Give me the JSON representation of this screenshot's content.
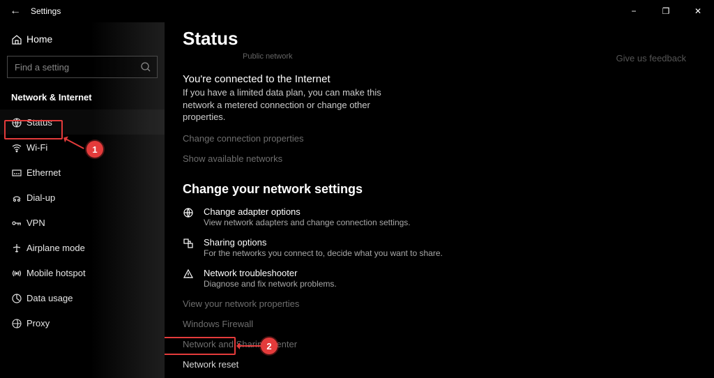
{
  "window": {
    "title": "Settings"
  },
  "sidebar": {
    "home": "Home",
    "search_placeholder": "Find a setting",
    "category": "Network & Internet",
    "items": [
      {
        "icon": "globe",
        "label": "Status"
      },
      {
        "icon": "wifi",
        "label": "Wi-Fi"
      },
      {
        "icon": "ethernet",
        "label": "Ethernet"
      },
      {
        "icon": "dialup",
        "label": "Dial-up"
      },
      {
        "icon": "vpn",
        "label": "VPN"
      },
      {
        "icon": "airplane",
        "label": "Airplane mode"
      },
      {
        "icon": "hotspot",
        "label": "Mobile hotspot"
      },
      {
        "icon": "data",
        "label": "Data usage"
      },
      {
        "icon": "proxy",
        "label": "Proxy"
      }
    ]
  },
  "main": {
    "page_title": "Status",
    "public_label": "Public network",
    "feedback": "Give us feedback",
    "connected_title": "You're connected to the Internet",
    "connected_sub": "If you have a limited data plan, you can make this network a metered connection or change other properties.",
    "link_props": "Change connection properties",
    "link_show": "Show available networks",
    "change_heading": "Change your network settings",
    "options": [
      {
        "title": "Change adapter options",
        "desc": "View network adapters and change connection settings."
      },
      {
        "title": "Sharing options",
        "desc": "For the networks you connect to, decide what you want to share."
      },
      {
        "title": "Network troubleshooter",
        "desc": "Diagnose and fix network problems."
      }
    ],
    "dim_links": [
      "View your network properties",
      "Windows Firewall",
      "Network and Sharing Center",
      "Network reset"
    ]
  },
  "annotations": {
    "one": "1",
    "two": "2"
  }
}
